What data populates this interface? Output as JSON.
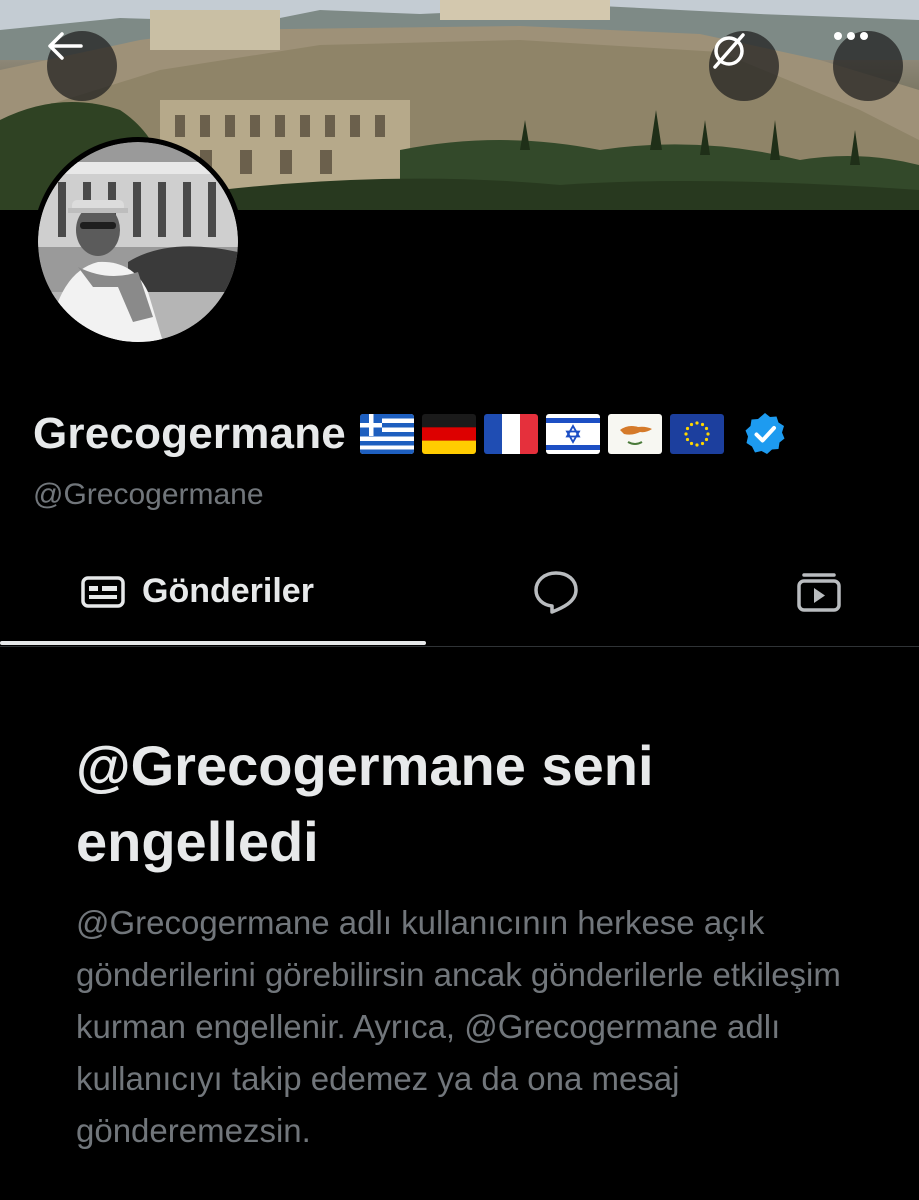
{
  "profile": {
    "display_name": "Grecogermane",
    "handle": "@Grecogermane",
    "flags": [
      "greece-flag",
      "germany-flag",
      "france-flag",
      "israel-flag",
      "cyprus-flag",
      "eu-flag"
    ],
    "verified_color": "#1d9bf0"
  },
  "header": {
    "back_icon": "arrow-left-icon",
    "grok_icon": "grok-icon",
    "more_icon": "more-horizontal-icon"
  },
  "tabs": [
    {
      "label": "Gönderiler",
      "icon": "posts-icon",
      "active": true
    },
    {
      "label": "",
      "icon": "replies-icon",
      "active": false
    },
    {
      "label": "",
      "icon": "media-icon",
      "active": false
    }
  ],
  "blocked": {
    "title": "@Grecogermane seni engelledi",
    "body": "@Grecogermane adlı kullanıcının herkese açık gönderilerini görebilirsin ancak gönderilerle etkileşim kurman engellenir. Ayrıca, @Grecogermane adlı kullanıcıyı takip edemez ya da ona mesaj gönderemezsin."
  },
  "colors": {
    "background": "#000000",
    "primary_text": "#e7e9ea",
    "secondary_text": "#71767b",
    "divider": "#2f3336",
    "accent": "#1d9bf0"
  }
}
